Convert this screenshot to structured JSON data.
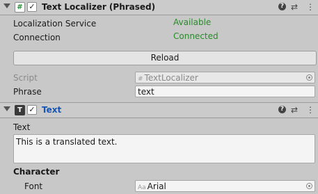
{
  "components": [
    {
      "title": "Text Localizer (Phrased)",
      "icon": "hash-script-icon",
      "fields": [
        {
          "label": "Localization Service",
          "value": "Available"
        },
        {
          "label": "Connection",
          "value": "Connected"
        }
      ],
      "button_label": "Reload",
      "script_label": "Script",
      "script_value": "TextLocalizer",
      "phrase_label": "Phrase",
      "phrase_value": "text"
    },
    {
      "title": "Text",
      "icon": "text-component-icon",
      "text_label": "Text",
      "text_value": "This is a translated text.",
      "section_label": "Character",
      "font_label": "Font",
      "font_prefix": "Aa",
      "font_value": "Arial"
    }
  ],
  "header_controls": {
    "help": "?",
    "preset": "⇄",
    "menu": "⋮"
  },
  "checkbox_glyph": "✓"
}
